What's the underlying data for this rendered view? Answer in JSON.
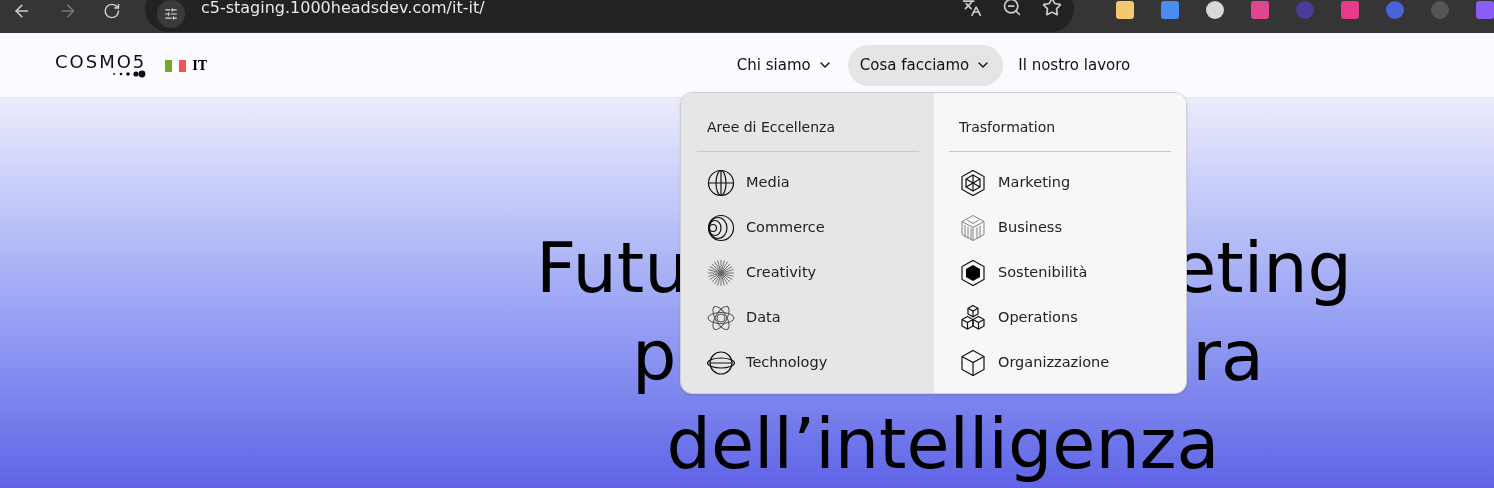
{
  "browser": {
    "url": "c5-staging.1000headsdev.com/it-it/"
  },
  "header": {
    "logo": "COSMO5",
    "language": "IT",
    "nav": [
      {
        "label": "Chi siamo",
        "has_menu": true,
        "selected": false
      },
      {
        "label": "Cosa facciamo",
        "has_menu": true,
        "selected": true
      },
      {
        "label": "Il nostro lavoro",
        "has_menu": false,
        "selected": false
      }
    ]
  },
  "menu": {
    "columns": [
      {
        "title": "Aree di Eccellenza",
        "items": [
          "Media",
          "Commerce",
          "Creativity",
          "Data",
          "Technology"
        ]
      },
      {
        "title": "Trasformation",
        "items": [
          "Marketing",
          "Business",
          "Sostenibilità",
          "Operations",
          "Organizzazione"
        ]
      }
    ]
  },
  "hero": {
    "lines": [
      [
        "Futu",
        "eting"
      ],
      [
        "p",
        "ra"
      ],
      [
        "dell’intelligenza"
      ]
    ]
  }
}
